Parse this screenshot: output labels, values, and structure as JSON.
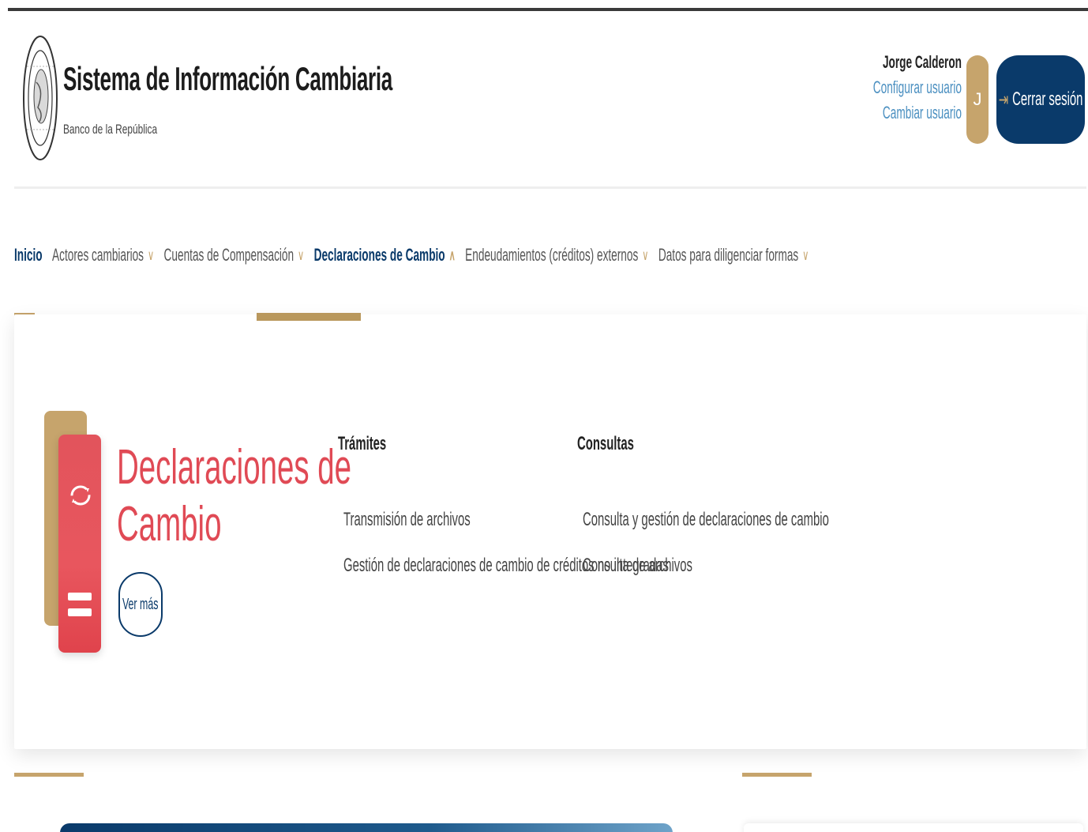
{
  "header": {
    "title": "Sistema de Información Cambiaria",
    "subtitle": "Banco de la República"
  },
  "user": {
    "name": "Jorge Calderon",
    "configure_link": "Configurar usuario",
    "change_link": "Cambiar usuario",
    "avatar_initial": "J",
    "logout_label": "Cerrar sesión"
  },
  "nav": {
    "items": [
      {
        "label": "Inicio",
        "active": true
      },
      {
        "label": "Actores cambiarios"
      },
      {
        "label": "Cuentas de Compensación"
      },
      {
        "label": "Declaraciones de Cambio"
      },
      {
        "label": "Endeudamientos (créditos) externos"
      },
      {
        "label": "Datos para diligenciar formas"
      }
    ],
    "chevron_down": "∨",
    "chevron_up": "∧"
  },
  "dropdown": {
    "title_line1": "Declaraciones de",
    "title_line2": "Cambio",
    "ver_mas": "Ver más",
    "tramites": {
      "heading": "Trámites",
      "links": [
        "Transmisión de archivos",
        "Gestión de declaraciones de cambio de créditos no integradas"
      ]
    },
    "consultas": {
      "heading": "Consultas",
      "links": [
        "Consulta y gestión de declaraciones de cambio",
        "Consulta de archivos"
      ]
    }
  },
  "colors": {
    "brand_navy": "#0a3a6a",
    "gold": "#c6a46c",
    "accent_red": "#e04a55",
    "link_blue": "#4a8fc0"
  },
  "icons": {
    "logout": "logout-icon",
    "sync": "sync-icon",
    "seal": "seal-logo"
  }
}
